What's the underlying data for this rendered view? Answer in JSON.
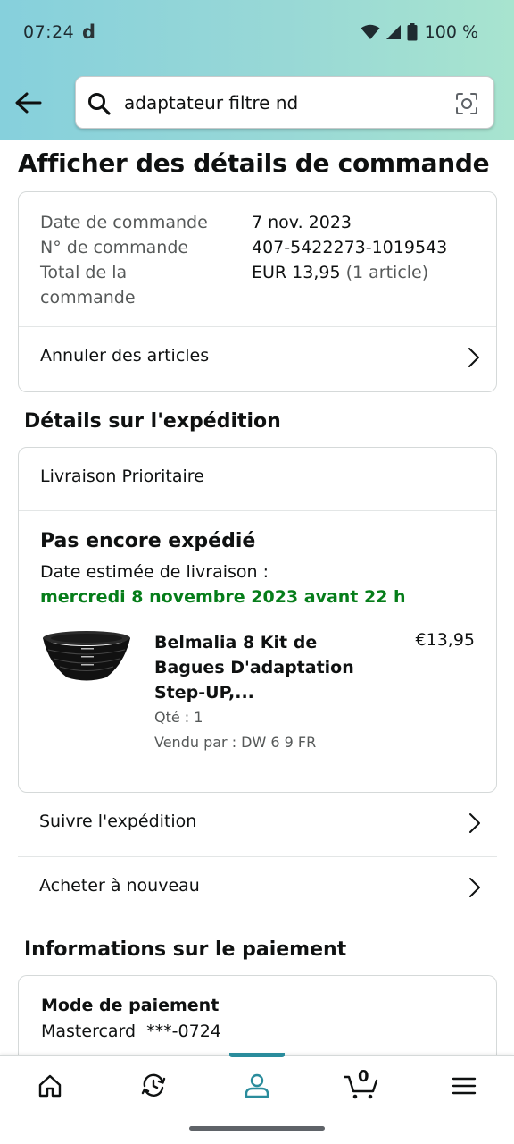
{
  "status_bar": {
    "time": "07:24",
    "app_indicator": "d",
    "battery": "100 %"
  },
  "search": {
    "query": "adaptateur filtre nd",
    "icon": "search-icon",
    "camera_icon": "lens-icon"
  },
  "page": {
    "title": "Afficher des détails de commande"
  },
  "order": {
    "date_label": "Date de commande",
    "date_value": "7 nov. 2023",
    "number_label": "N° de commande",
    "number_value": "407-5422273-1019543",
    "total_label": "Total de la commande",
    "total_value": "EUR 13,95",
    "total_sub": "(1 article)",
    "cancel_label": "Annuler des articles"
  },
  "shipping": {
    "section_title": "Détails sur l'expédition",
    "type": "Livraison Prioritaire",
    "status": "Pas encore expédié",
    "delivery_label": "Date estimée de livraison :",
    "delivery_date": "mercredi 8 novembre 2023 avant 22 h",
    "product": {
      "name": "Belmalia 8 Kit de Bagues D'adaptation Step-UP,...",
      "price": "€13,95",
      "qty": "Qté : 1",
      "seller": "Vendu par : DW 6 9 FR"
    },
    "track_label": "Suivre l'expédition",
    "buy_again_label": "Acheter à nouveau"
  },
  "payment": {
    "section_title": "Informations sur le paiement",
    "method_label": "Mode de paiement",
    "method_value": "Mastercard  ***-0724"
  },
  "bottom_nav": {
    "items": [
      "home-icon",
      "returns-icon",
      "account-icon",
      "cart-icon",
      "menu-icon"
    ],
    "active": "account-icon",
    "cart_count": "0",
    "accent": "#2a8c9c"
  },
  "colors": {
    "delivery_green": "#067d1a",
    "header_gradient_start": "#86d0dc",
    "header_gradient_end": "#a8e4cf"
  }
}
